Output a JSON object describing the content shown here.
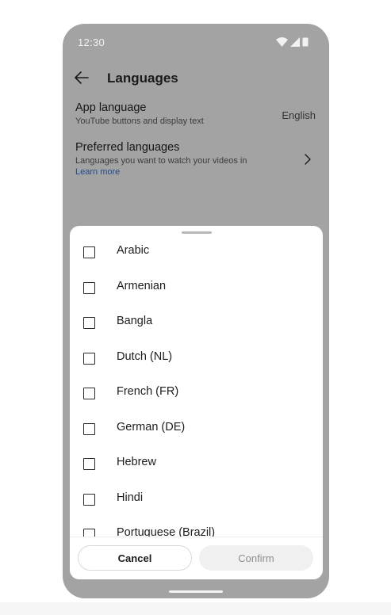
{
  "status_bar": {
    "time": "12:30",
    "icons": [
      "wifi-icon",
      "cellular-signal-icon",
      "battery-icon"
    ]
  },
  "header": {
    "title": "Languages",
    "back_icon": "back-arrow-icon"
  },
  "settings": {
    "app_language": {
      "title": "App language",
      "subtitle": "YouTube buttons and display text",
      "value": "English"
    },
    "preferred_languages": {
      "title": "Preferred languages",
      "subtitle": "Languages you want to watch your videos in",
      "link": "Learn more",
      "icon": "chevron-right-icon"
    }
  },
  "sheet": {
    "languages": [
      {
        "label": "Arabic",
        "checked": false
      },
      {
        "label": "Armenian",
        "checked": false
      },
      {
        "label": "Bangla",
        "checked": false
      },
      {
        "label": "Dutch (NL)",
        "checked": false
      },
      {
        "label": "French (FR)",
        "checked": false
      },
      {
        "label": "German (DE)",
        "checked": false
      },
      {
        "label": "Hebrew",
        "checked": false
      },
      {
        "label": "Hindi",
        "checked": false
      },
      {
        "label": "Portuguese (Brazil)",
        "checked": false
      }
    ],
    "cancel_label": "Cancel",
    "confirm_label": "Confirm"
  },
  "colors": {
    "scrim": "#a3a3a3",
    "link": "#234a8a",
    "sheet_bg": "#ffffff"
  }
}
